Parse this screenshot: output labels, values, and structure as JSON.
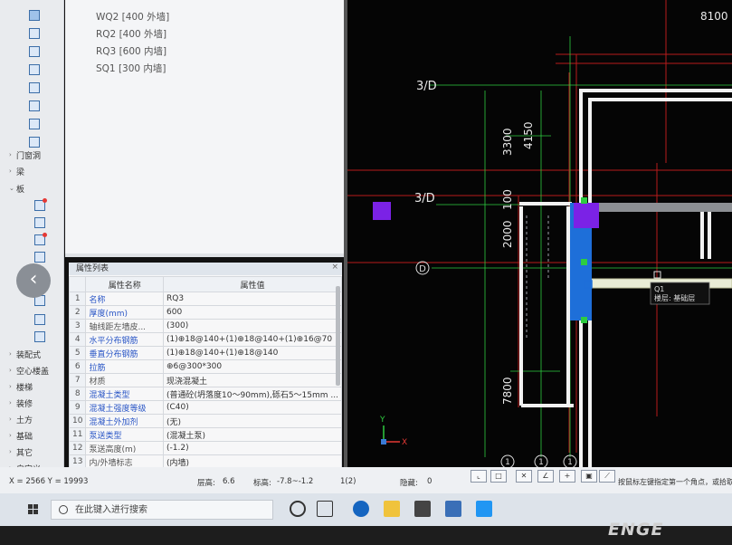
{
  "component_list": [
    "WQ2 [400 外墙]",
    "RQ2 [400 外墙]",
    "RQ3 [600 内墙]",
    "SQ1 [300 内墙]"
  ],
  "tree": {
    "categories": [
      "门窗洞",
      "梁",
      "板",
      "装配式",
      "空心楼盖",
      "楼梯",
      "装修",
      "土方",
      "基础",
      "其它",
      "自定义"
    ]
  },
  "properties": {
    "title": "属性列表",
    "col_name": "属性名称",
    "col_value": "属性值",
    "rows": [
      {
        "n": "1",
        "name": "名称",
        "value": "RQ3",
        "style": "blue"
      },
      {
        "n": "2",
        "name": "厚度(mm)",
        "value": "600",
        "style": "blue"
      },
      {
        "n": "3",
        "name": "轴线距左墙皮...",
        "value": "(300)",
        "style": "gray"
      },
      {
        "n": "4",
        "name": "水平分布钢筋",
        "value": "(1)⊕18@140+(1)⊕18@140+(1)⊕16@70",
        "style": "blue"
      },
      {
        "n": "5",
        "name": "垂直分布钢筋",
        "value": "(1)⊕18@140+(1)⊕18@140",
        "style": "blue"
      },
      {
        "n": "6",
        "name": "拉筋",
        "value": "⊕6@300*300",
        "style": "blue"
      },
      {
        "n": "7",
        "name": "材质",
        "value": "现浇混凝土",
        "style": "gray"
      },
      {
        "n": "8",
        "name": "混凝土类型",
        "value": "(普通砼(坍落度10～90mm),砾石5～15mm ...",
        "style": "blue"
      },
      {
        "n": "9",
        "name": "混凝土强度等级",
        "value": "(C40)",
        "style": "blue"
      },
      {
        "n": "10",
        "name": "混凝土外加剂",
        "value": "(无)",
        "style": "blue"
      },
      {
        "n": "11",
        "name": "泵送类型",
        "value": "(混凝土泵)",
        "style": "blue"
      },
      {
        "n": "12",
        "name": "泵送高度(m)",
        "value": "(-1.2)",
        "style": "gray"
      },
      {
        "n": "13",
        "name": "内/外墙标志",
        "value": "(内墙)",
        "style": "gray"
      }
    ]
  },
  "cad": {
    "dim_8100": "8100",
    "axis_3D_top": "3/D",
    "axis_3D_mid": "3/D",
    "axis_D": "D",
    "dim_3300": "3300",
    "dim_4150": "4150",
    "dim_100": "100",
    "dim_2000": "2000",
    "dim_7800": "7800",
    "axis_1a": "1",
    "axis_1b": "1",
    "axis_1c": "1",
    "tooltip_name": "Q1",
    "tooltip_layer": "楼层: 基础层",
    "y_label": "Y",
    "x_label": "X"
  },
  "status": {
    "coords": "X = 2566 Y = 19993",
    "floor_height_label": "层高:",
    "floor_height": "6.6",
    "elev_label": "标高:",
    "elev": "-7.8~-1.2",
    "count": "1(2)",
    "hidden_label": "隐藏:",
    "hidden": "0",
    "hint": "按鼠标左键指定第一个角点，或拾取"
  },
  "taskbar": {
    "search_placeholder": "在此键入进行搜索"
  },
  "brand": "ENGE",
  "colors": {
    "accent_blue": "#1e6fd9",
    "purple": "#7b22e6",
    "green": "#2ecc40",
    "wall_red": "#d32f2f"
  }
}
